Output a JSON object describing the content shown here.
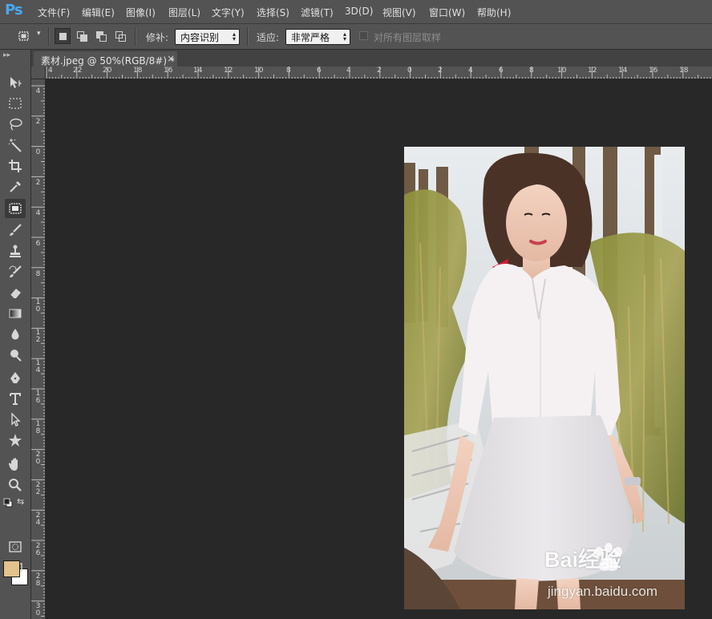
{
  "app": {
    "logo": "Ps"
  },
  "menu": [
    {
      "label": "文件(F)"
    },
    {
      "label": "编辑(E)"
    },
    {
      "label": "图像(I)"
    },
    {
      "label": "图层(L)"
    },
    {
      "label": "文字(Y)"
    },
    {
      "label": "选择(S)"
    },
    {
      "label": "滤镜(T)"
    },
    {
      "label": "3D(D)"
    },
    {
      "label": "视图(V)"
    },
    {
      "label": "窗口(W)"
    },
    {
      "label": "帮助(H)"
    }
  ],
  "options": {
    "patch_label": "修补:",
    "patch_value": "内容识别",
    "adapt_label": "适应:",
    "adapt_value": "非常严格",
    "sample_all_layers_label": "对所有图层取样",
    "sample_all_layers_checked": false
  },
  "document": {
    "tab_title": "素材.jpeg @ 50%(RGB/8#) *",
    "close_glyph": "×"
  },
  "ruler": {
    "horizontal": [
      "4",
      "22",
      "20",
      "18",
      "16",
      "14",
      "12",
      "10",
      "8",
      "6",
      "4",
      "2",
      "0",
      "2",
      "4",
      "6",
      "8",
      "10",
      "12",
      "14",
      "16",
      "18"
    ],
    "vertical": [
      "4",
      "2",
      "0",
      "2",
      "4",
      "6",
      "8",
      "10",
      "12",
      "14",
      "16",
      "18",
      "20",
      "22",
      "24",
      "26",
      "28",
      "30"
    ]
  },
  "colors": {
    "foreground": "#e2c28e",
    "background": "#ffffff",
    "accent_logo": "#48a9f0"
  },
  "watermark": {
    "brand": "Bai经验",
    "url": "jingyan.baidu.com"
  },
  "tools": [
    {
      "icon": "move-tool-icon"
    },
    {
      "icon": "marquee-tool-icon"
    },
    {
      "icon": "lasso-tool-icon"
    },
    {
      "icon": "magic-wand-tool-icon"
    },
    {
      "icon": "crop-tool-icon"
    },
    {
      "icon": "eyedropper-tool-icon"
    },
    {
      "icon": "patch-tool-icon"
    },
    {
      "icon": "brush-tool-icon"
    },
    {
      "icon": "stamp-tool-icon"
    },
    {
      "icon": "history-brush-tool-icon"
    },
    {
      "icon": "eraser-tool-icon"
    },
    {
      "icon": "gradient-tool-icon"
    },
    {
      "icon": "blur-tool-icon"
    },
    {
      "icon": "dodge-tool-icon"
    },
    {
      "icon": "pen-tool-icon"
    },
    {
      "icon": "type-tool-icon"
    },
    {
      "icon": "path-selection-tool-icon"
    },
    {
      "icon": "shape-tool-icon"
    },
    {
      "icon": "hand-tool-icon"
    },
    {
      "icon": "zoom-tool-icon"
    }
  ]
}
